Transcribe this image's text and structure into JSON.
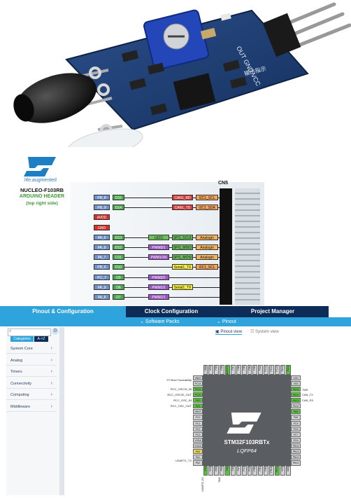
{
  "photo": {
    "silkscreen_top": "OUT GND VCC",
    "silkscreen_bottom": "输出指示"
  },
  "diagram": {
    "brand_tagline": "life.augmented",
    "board_name": "NUCLEO-F103RB",
    "header_name": "ARDUINO HEADER",
    "side_note": "(top right side)",
    "connector": "CN5",
    "rows": [
      {
        "port": "PB_8",
        "dig": "D15",
        "f1": "CAN1_RD",
        "f1c": "red",
        "f2": "I2C1_SCL",
        "f2c": "orange"
      },
      {
        "port": "PB_9",
        "dig": "D14",
        "f1": "CAN1_TD",
        "f1c": "red",
        "f2": "I2C1_SDA",
        "f2c": "orange"
      },
      {
        "port": "AVDD",
        "dig": "",
        "f1": "",
        "f1c": "",
        "f2": "",
        "f2c": ""
      },
      {
        "port": "GND",
        "dig": "",
        "f1": "",
        "f1c": "",
        "f2": "",
        "f2c": ""
      },
      {
        "port": "PA_5",
        "dig": "D13",
        "f0": "LED1",
        "f1": "SPI1_SCLK",
        "f1c": "green",
        "f2": "Analogin",
        "f2c": "analog"
      },
      {
        "port": "PA_6",
        "dig": "D12",
        "f0": "PWM3/1",
        "f1": "SPI1_MISO",
        "f1c": "green",
        "f2": "Analogin",
        "f2c": "analog"
      },
      {
        "port": "PA_7",
        "dig": "D11",
        "f0": "PWM1/1N",
        "f1": "SPI1_MOSI",
        "f1c": "green",
        "f2": "Analogin",
        "f2c": "analog"
      },
      {
        "port": "PB_6",
        "dig": "D10",
        "f0": "",
        "f1": "Serial1_TX",
        "f1c": "yellow",
        "f2": "I2C1_SCL",
        "f2c": "orange"
      },
      {
        "port": "PC_7",
        "dig": "D9",
        "f0": "PWM3/2",
        "f1": "",
        "f1c": "",
        "f2": "",
        "f2c": ""
      },
      {
        "port": "PA_9",
        "dig": "D8",
        "f0": "PWM1/2",
        "f1": "Serial1_TX",
        "f1c": "yellow",
        "f2": "",
        "f2c": ""
      },
      {
        "port": "PA_8",
        "dig": "D7",
        "f0": "PWM1/1",
        "f1": "",
        "f1c": "",
        "f2": "",
        "f2c": ""
      }
    ]
  },
  "cubemx": {
    "tabs": [
      "Pinout & Configuration",
      "Clock Configuration",
      "Project Manager"
    ],
    "subtabs": [
      "Software Packs",
      "Pinout"
    ],
    "view_toggle": [
      "Pinout view",
      "System view"
    ],
    "search_placeholder": "",
    "filter_tabs": [
      "Categories",
      "A->Z"
    ],
    "categories": [
      "System Core",
      "Analog",
      "Timers",
      "Connectivity",
      "Computing",
      "Middleware"
    ],
    "chip": {
      "name": "STM32F103RBTx",
      "package": "LQFP64"
    },
    "left_labels": [
      "ST Boot Traceability",
      "RCC_OSC32_IN",
      "RCC_OSC32_OUT",
      "RCC_OSC_IN",
      "RCC_OSC_OUT",
      "USART1_TX"
    ],
    "right_labels": [
      "TMS",
      "CAN_TX",
      "CAN_RX"
    ],
    "top_pins": [
      "VDD",
      "VSS",
      "PB9",
      "PB8",
      "BOOT0",
      "PB7",
      "PB6",
      "PB5",
      "PB4",
      "PB3",
      "PD2",
      "PC12",
      "PC11",
      "PC10",
      "PA15",
      "PA14"
    ],
    "bottom_pins": [
      "PA3",
      "VSS",
      "VDD",
      "PA4",
      "PA5",
      "PA6",
      "PA7",
      "PC4",
      "PC5",
      "PB0",
      "PB1",
      "PB2",
      "PB10",
      "PB11",
      "VSS",
      "VDD"
    ],
    "left_pins": [
      "VBAT",
      "PC13",
      "PC14",
      "PC15",
      "PD0",
      "PD1",
      "NRST",
      "PC0",
      "PC1",
      "PC2",
      "PC3",
      "VSSA",
      "VDDA",
      "PA0",
      "PA1",
      "PA2"
    ],
    "right_pins": [
      "VDD",
      "VSS",
      "PA13",
      "PA12",
      "PA11",
      "PA10",
      "PA9",
      "PA8",
      "PC9",
      "PC8",
      "PC7",
      "PC6",
      "PB15",
      "PB14",
      "PB13",
      "PB12"
    ],
    "bottom_signals": [
      "USART2_RX",
      "TIM2"
    ]
  }
}
